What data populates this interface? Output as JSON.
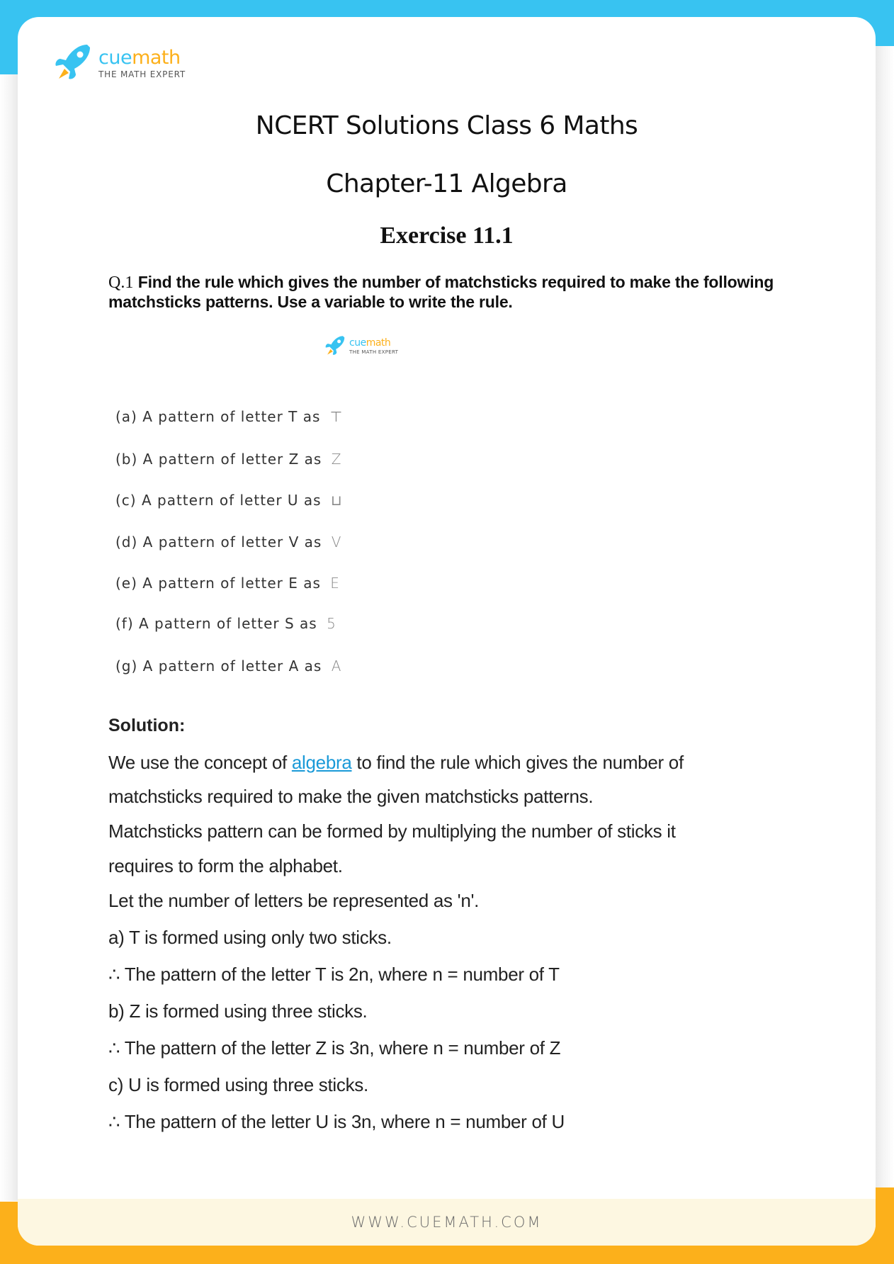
{
  "brand": {
    "name_part1": "cue",
    "name_part2": "math",
    "tagline": "THE MATH EXPERT",
    "colors": {
      "blue": "#38c3f1",
      "orange": "#fcb01b",
      "cream": "#fdf7e1",
      "link": "#1a9ad8"
    }
  },
  "header": {
    "title": "NCERT Solutions Class 6 Maths",
    "chapter": "Chapter-11 Algebra",
    "exercise": "Exercise 11.1"
  },
  "question": {
    "number": "Q.1",
    "text": "Find the rule which gives the number of matchsticks required to make the following matchsticks patterns. Use a variable to write the rule."
  },
  "options": [
    {
      "label": "(a)",
      "text": "A pattern of letter T as",
      "pattern": "⊤"
    },
    {
      "label": "(b)",
      "text": "A pattern of letter Z as",
      "pattern": "Z"
    },
    {
      "label": "(c)",
      "text": "A pattern of letter U as",
      "pattern": "⊔"
    },
    {
      "label": "(d)",
      "text": "A pattern of letter V as",
      "pattern": "V"
    },
    {
      "label": "(e)",
      "text": "A pattern of letter E as",
      "pattern": "E"
    },
    {
      "label": "(f)",
      "text": "A pattern of letter S as",
      "pattern": "5"
    },
    {
      "label": "(g)",
      "text": "A pattern of letter A as",
      "pattern": "A"
    }
  ],
  "solution": {
    "heading": "Solution:",
    "intro_before_link": "We use the concept of ",
    "link_text": "algebra",
    "intro_after_link": " to find the rule which gives the number of",
    "intro_line2": "matchsticks required to make the given matchsticks patterns.",
    "para2_line1": "Matchsticks pattern can be formed by multiplying the number of sticks it",
    "para2_line2": "requires to form the alphabet.",
    "let_line": "Let the number of letters be represented as 'n'.",
    "steps": [
      "a) T is formed using only two sticks.",
      "∴ The pattern of the letter T is 2n, where n = number of T",
      "b) Z is formed using three sticks.",
      "∴ The pattern of the letter Z is 3n, where n = number of Z",
      "c) U is formed using three sticks.",
      "∴ The pattern of the letter U is 3n, where n = number of U"
    ]
  },
  "footer": {
    "url": "WWW.CUEMATH.COM"
  }
}
